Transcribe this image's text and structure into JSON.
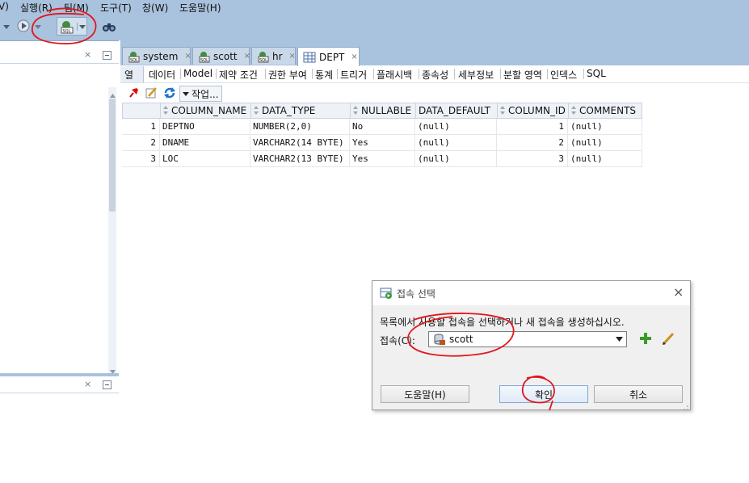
{
  "menu": {
    "partial_first": "V)",
    "items": [
      "실행(R)",
      "팀(M)",
      "도구(T)",
      "창(W)",
      "도움말(H)"
    ]
  },
  "toolbar": {
    "icons": [
      "back-arrow-icon",
      "run-icon",
      "dropdown-icon",
      "sql-worksheet-icon",
      "binoculars-icon"
    ]
  },
  "left_panel": {
    "top_close": "×",
    "bottom_close": "×"
  },
  "tabs": [
    {
      "label": "system",
      "icon": "sql-icon",
      "active": false
    },
    {
      "label": "scott",
      "icon": "sql-icon",
      "active": false
    },
    {
      "label": "hr",
      "icon": "sql-icon",
      "active": false
    },
    {
      "label": "DEPT",
      "icon": "table-icon",
      "active": true
    }
  ],
  "tab_close": "×",
  "subtabs": [
    "열",
    "데이터",
    "Model",
    "제약 조건",
    "권한 부여",
    "통계",
    "트리거",
    "플래시백",
    "종속성",
    "세부정보",
    "분할 영역",
    "인덱스",
    "SQL"
  ],
  "actions": {
    "work_label": "작업..."
  },
  "grid": {
    "columns": [
      "COLUMN_NAME",
      "DATA_TYPE",
      "NULLABLE",
      "DATA_DEFAULT",
      "COLUMN_ID",
      "COMMENTS"
    ],
    "rows": [
      {
        "n": "1",
        "name": "DEPTNO",
        "type": "NUMBER(2,0)",
        "nullable": "No",
        "default": "(null)",
        "id": "1",
        "comments": "(null)"
      },
      {
        "n": "2",
        "name": "DNAME",
        "type": "VARCHAR2(14 BYTE)",
        "nullable": "Yes",
        "default": "(null)",
        "id": "2",
        "comments": "(null)"
      },
      {
        "n": "3",
        "name": "LOC",
        "type": "VARCHAR2(13 BYTE)",
        "nullable": "Yes",
        "default": "(null)",
        "id": "3",
        "comments": "(null)"
      }
    ]
  },
  "dialog": {
    "title": "접속 선택",
    "message": "목록에서 사용할 접속을 선택하거나 새 접속을 생성하십시오.",
    "conn_label": "접속(C):",
    "selected": "scott",
    "help": "도움말(H)",
    "ok": "확인",
    "cancel": "취소",
    "close": "×"
  },
  "colors": {
    "chrome": "#a9c2dd",
    "annotation": "#e0161b"
  }
}
